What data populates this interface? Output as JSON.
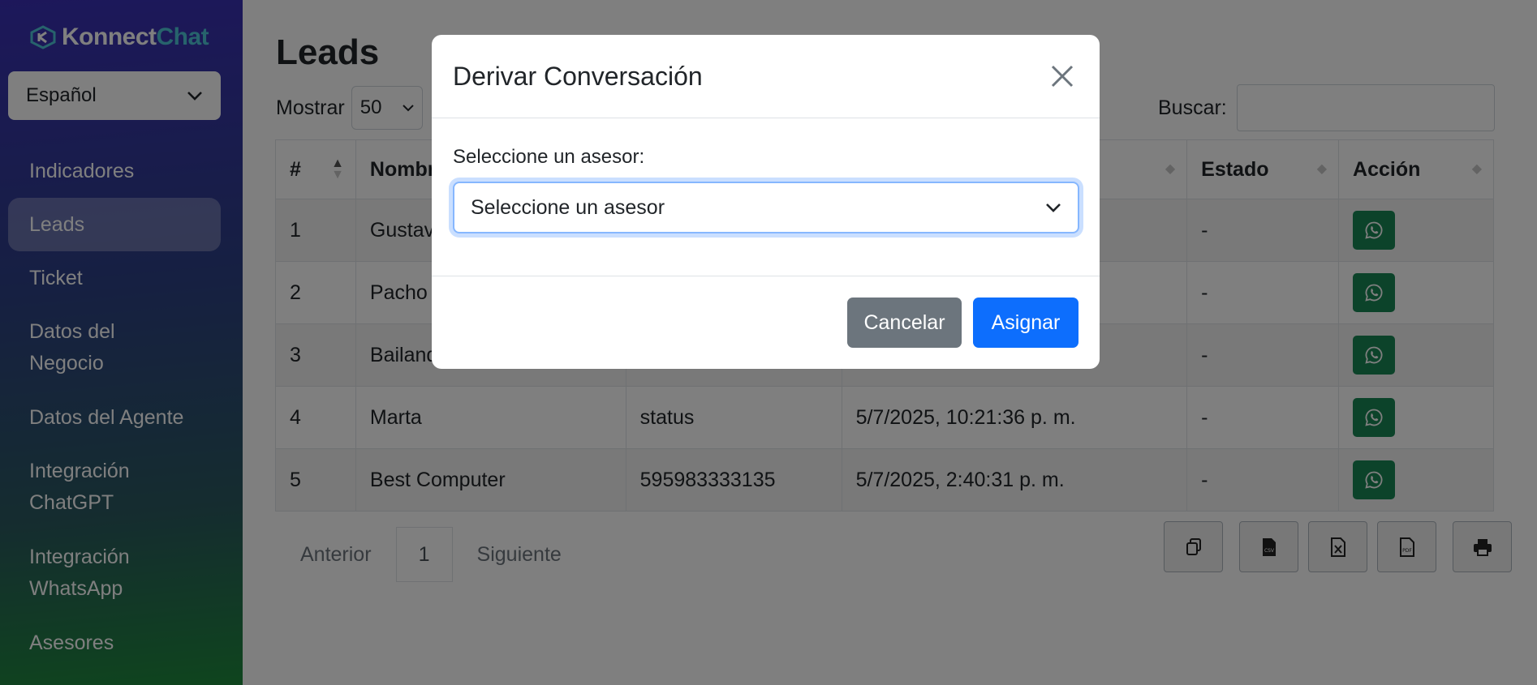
{
  "brand": {
    "part1": "Konnect",
    "part2": "Chat",
    "accent": "#4ec7d8"
  },
  "language": {
    "selected": "Español"
  },
  "sidebar": {
    "items": [
      {
        "label": "Indicadores",
        "active": false
      },
      {
        "label": "Leads",
        "active": true
      },
      {
        "label": "Ticket",
        "active": false
      },
      {
        "label": "Datos del Negocio",
        "active": false
      },
      {
        "label": "Datos del Agente",
        "active": false
      },
      {
        "label": "Integración ChatGPT",
        "active": false
      },
      {
        "label": "Integración WhatsApp",
        "active": false
      },
      {
        "label": "Asesores",
        "active": false
      }
    ]
  },
  "page": {
    "title": "Leads",
    "show_label": "Mostrar",
    "show_value": "50",
    "search_label": "Buscar:",
    "search_value": ""
  },
  "table": {
    "columns": [
      "#",
      "Nombre",
      "",
      "",
      "Estado",
      "Acción"
    ],
    "rows": [
      {
        "num": "1",
        "name": "Gustavo",
        "phone": "",
        "date": "",
        "status": "-"
      },
      {
        "num": "2",
        "name": "Pacho",
        "phone": "",
        "date": "",
        "status": "-"
      },
      {
        "num": "3",
        "name": "Bailando",
        "phone": "",
        "date": "",
        "status": "-"
      },
      {
        "num": "4",
        "name": "Marta",
        "phone": "status",
        "date": "5/7/2025, 10:21:36 p. m.",
        "status": "-"
      },
      {
        "num": "5",
        "name": "Best Computer",
        "phone": "595983333135",
        "date": "5/7/2025, 2:40:31 p. m.",
        "status": "-"
      }
    ]
  },
  "pagination": {
    "prev": "Anterior",
    "page": "1",
    "next": "Siguiente"
  },
  "exports": [
    "copy-icon",
    "csv-icon",
    "excel-icon",
    "pdf-icon",
    "print-icon"
  ],
  "modal": {
    "title": "Derivar Conversación",
    "label": "Seleccione un asesor:",
    "select_value": "Seleccione un asesor",
    "cancel_label": "Cancelar",
    "assign_label": "Asignar"
  },
  "colors": {
    "primary": "#0d6efd",
    "secondary": "#6c757d",
    "whatsapp": "#198754"
  }
}
